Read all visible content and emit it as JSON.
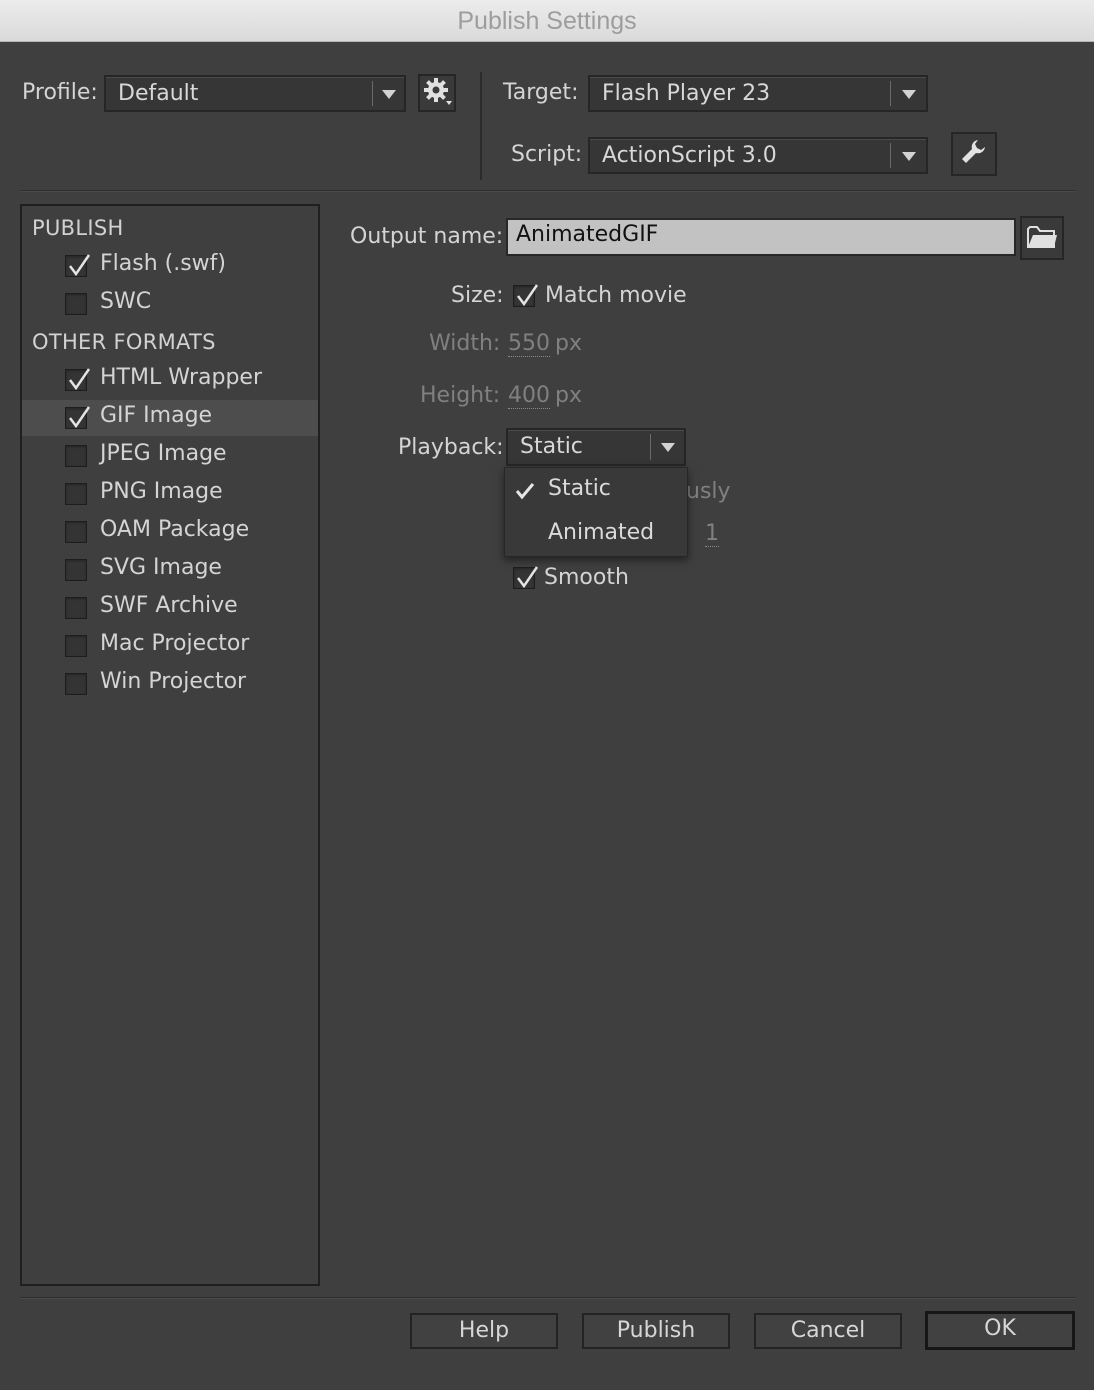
{
  "window": {
    "title": "Publish Settings"
  },
  "header": {
    "profile_label": "Profile:",
    "profile_value": "Default",
    "target_label": "Target:",
    "target_value": "Flash Player 23",
    "script_label": "Script:",
    "script_value": "ActionScript 3.0"
  },
  "sidebar": {
    "publish_heading": "PUBLISH",
    "publish_items": [
      {
        "label": "Flash (.swf)",
        "checked": true
      },
      {
        "label": "SWC",
        "checked": false
      }
    ],
    "other_heading": "OTHER FORMATS",
    "other_items": [
      {
        "label": "HTML Wrapper",
        "checked": true
      },
      {
        "label": "GIF Image",
        "checked": true,
        "selected": true
      },
      {
        "label": "JPEG Image",
        "checked": false
      },
      {
        "label": "PNG Image",
        "checked": false
      },
      {
        "label": "OAM Package",
        "checked": false
      },
      {
        "label": "SVG Image",
        "checked": false
      },
      {
        "label": "SWF Archive",
        "checked": false
      },
      {
        "label": "Mac Projector",
        "checked": false
      },
      {
        "label": "Win Projector",
        "checked": false
      }
    ]
  },
  "gif_settings": {
    "output_name_label": "Output name:",
    "output_name_value": "AnimatedGIF",
    "size_label": "Size:",
    "match_movie_label": "Match movie",
    "match_movie_checked": true,
    "width_label": "Width:",
    "width_value": "550",
    "height_label": "Height:",
    "height_value": "400",
    "unit": "px",
    "playback_label": "Playback:",
    "playback_value": "Static",
    "playback_options": [
      {
        "label": "Static",
        "checked": true
      },
      {
        "label": "Animated",
        "checked": false
      }
    ],
    "obscured_loop_text": "usly",
    "obscured_repeat_value": "1",
    "smooth_label": "Smooth",
    "smooth_checked": true
  },
  "footer": {
    "help_label": "Help",
    "publish_label": "Publish",
    "cancel_label": "Cancel",
    "ok_label": "OK"
  }
}
